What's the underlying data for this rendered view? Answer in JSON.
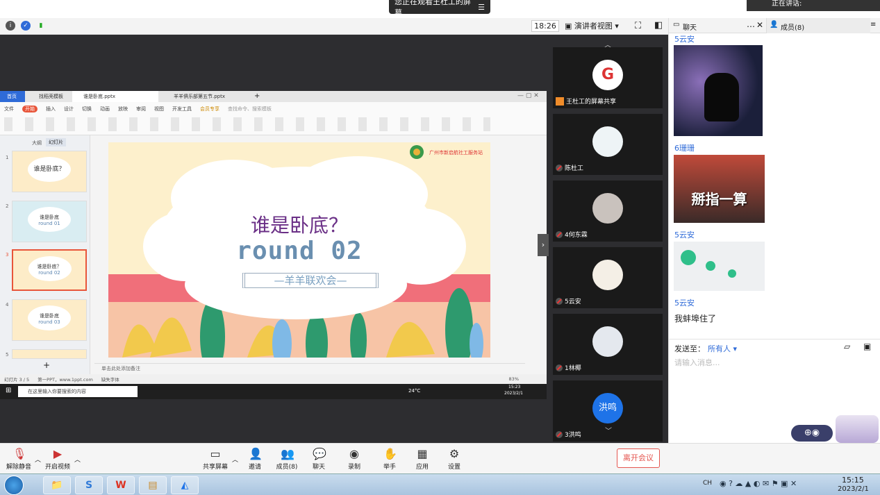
{
  "banner": {
    "watching": "您正在观看王杜工的屏幕",
    "speaking": "正在讲话:"
  },
  "toolbar": {
    "time": "18:26",
    "view": "演讲者视图"
  },
  "tabs": {
    "chat": "聊天",
    "members": "成员(8)"
  },
  "wps": {
    "tabs": [
      "首页",
      "找稻壳模板",
      "谁是卧底.pptx",
      "羊羊俱乐部第五节.pptx"
    ],
    "menu": [
      "文件",
      "开始",
      "插入",
      "设计",
      "切换",
      "动画",
      "放映",
      "审阅",
      "视图",
      "开发工具",
      "会员专享",
      "查找命令、搜索模板"
    ],
    "panel_tabs": [
      "大纲",
      "幻灯片"
    ],
    "slide_numbers": [
      "1",
      "2",
      "3",
      "4",
      "5"
    ],
    "thumbs": [
      {
        "title": "谁是卧底？",
        "sub": ""
      },
      {
        "title": "谁是卧底",
        "sub": "round 01"
      },
      {
        "title": "谁是卧底？",
        "sub": "round 02"
      },
      {
        "title": "谁是卧底",
        "sub": "round 03"
      },
      {
        "title": "",
        "sub": ""
      }
    ],
    "notes": "单击此处添加备注",
    "status_left": "幻灯片 3 / 5",
    "status_theme": "第一PPT，www.1ppt.com",
    "status_font": "缺失字体",
    "zoom": "83%",
    "add": "+"
  },
  "slide": {
    "title": "谁是卧底？",
    "round": "round 02",
    "subtitle": "—羊羊联欢会—",
    "org": "广州市新启航社工服务站"
  },
  "inner_taskbar": {
    "search": "在这里输入你要搜索的内容",
    "temp": "24°C",
    "time": "15:23",
    "date": "2023/2/1"
  },
  "participants": [
    {
      "name": "王杜工的屏幕共享",
      "tag": "G"
    },
    {
      "name": "陈杜工",
      "tag": ""
    },
    {
      "name": "4何东霖",
      "tag": ""
    },
    {
      "name": "5云安",
      "tag": ""
    },
    {
      "name": "1林椰",
      "tag": ""
    },
    {
      "name": "3洪鸣",
      "tag": "洪鸣"
    }
  ],
  "chat": {
    "messages": [
      {
        "sender": "5云安",
        "type": "image"
      },
      {
        "sender": "6珊珊",
        "type": "image",
        "caption": "掰指一算"
      },
      {
        "sender": "5云安",
        "type": "image"
      },
      {
        "sender": "5云安",
        "type": "text",
        "text": "我蚌埠住了"
      }
    ],
    "send_to_label": "发送至：",
    "send_to_value": "所有人",
    "placeholder": "请输入消息..."
  },
  "bottom": {
    "buttons": [
      "解除静音",
      "开启视频",
      "共享屏幕",
      "邀请",
      "成员(8)",
      "聊天",
      "录制",
      "举手",
      "应用",
      "设置"
    ],
    "leave": "离开会议"
  },
  "os_taskbar": {
    "time": "15:15",
    "date": "2023/2/1",
    "lang": "CH"
  }
}
